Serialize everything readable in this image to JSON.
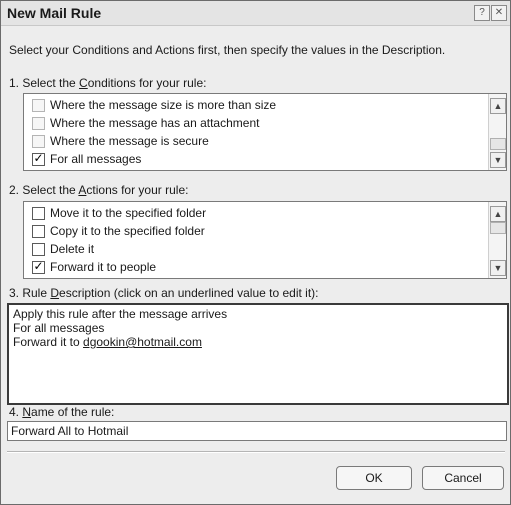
{
  "window": {
    "title": "New Mail Rule",
    "help_icon": "help-icon",
    "close_icon": "close-icon"
  },
  "intro": "Select your Conditions and Actions first, then specify the values in the Description.",
  "conditions": {
    "label_pre": "1. Select the ",
    "label_key": "C",
    "label_post": "onditions for your rule:",
    "items": [
      {
        "label": "Where the message size is more than size",
        "checked": false,
        "disabled": true
      },
      {
        "label": "Where the message has an attachment",
        "checked": false,
        "disabled": true
      },
      {
        "label": "Where the message is secure",
        "checked": false,
        "disabled": true
      },
      {
        "label": "For all messages",
        "checked": true,
        "disabled": false
      }
    ]
  },
  "actions": {
    "label_pre": "2. Select the ",
    "label_key": "A",
    "label_post": "ctions for your rule:",
    "items": [
      {
        "label": "Move it to the specified folder",
        "checked": false,
        "disabled": false
      },
      {
        "label": "Copy it to the specified folder",
        "checked": false,
        "disabled": false
      },
      {
        "label": "Delete it",
        "checked": false,
        "disabled": false
      },
      {
        "label": "Forward it to people",
        "checked": true,
        "disabled": false
      }
    ]
  },
  "description": {
    "label_pre": "3. Rule ",
    "label_key": "D",
    "label_post": "escription (click on an underlined value to edit it):",
    "line1": "Apply this rule after the message arrives",
    "line2": "For all messages",
    "line3_pre": "Forward it to ",
    "line3_link": "dgookin@hotmail.com"
  },
  "name": {
    "label_pre": "4. ",
    "label_key": "N",
    "label_post": "ame of the rule:",
    "value": "Forward All to Hotmail"
  },
  "buttons": {
    "ok": "OK",
    "cancel": "Cancel"
  }
}
